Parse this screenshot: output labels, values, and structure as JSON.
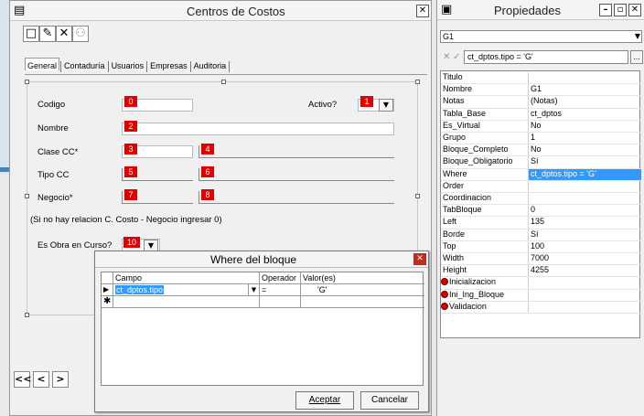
{
  "main_window": {
    "title": "Centros de Costos",
    "tabs": [
      "General",
      "Contaduría",
      "Usuarios",
      "Empresas",
      "Auditoria"
    ],
    "fields": {
      "codigo_label": "Codigo",
      "codigo_tag": "0",
      "activo_label": "Activo?",
      "activo_tag": "1",
      "nombre_label": "Nombre",
      "nombre_tag": "2",
      "clase_label": "Clase CC*",
      "clase_tag": "3",
      "clase_tag2": "4",
      "tipo_label": "Tipo CC",
      "tipo_tag": "5",
      "tipo_tag2": "6",
      "negocio_label": "Negocio*",
      "negocio_tag": "7",
      "negocio_tag2": "8",
      "note": "(Si no hay relacion C. Costo - Negocio ingresar 0)",
      "obra_label": "Es Obra en Curso?",
      "obra_tag": "10"
    },
    "nav": [
      "<<",
      "<",
      ">"
    ]
  },
  "properties": {
    "title": "Propiedades",
    "selector_value": "G1",
    "edit_value": "ct_dptos.tipo = 'G'",
    "rows": [
      {
        "name": "Titulo",
        "value": ""
      },
      {
        "name": "Nombre",
        "value": "G1"
      },
      {
        "name": "Notas",
        "value": "(Notas)"
      },
      {
        "name": "Tabla_Base",
        "value": "ct_dptos"
      },
      {
        "name": "Es_Virtual",
        "value": "No"
      },
      {
        "name": "Grupo",
        "value": "1"
      },
      {
        "name": "Bloque_Completo",
        "value": "No"
      },
      {
        "name": "Bloque_Obligatorio",
        "value": "Sí"
      },
      {
        "name": "Where",
        "value": "ct_dptos.tipo = 'G'"
      },
      {
        "name": "Order",
        "value": ""
      },
      {
        "name": "Coordinacion",
        "value": ""
      },
      {
        "name": "TabBloque",
        "value": "0"
      },
      {
        "name": "Left",
        "value": "135"
      },
      {
        "name": "Borde",
        "value": "Sí"
      },
      {
        "name": "Top",
        "value": "100"
      },
      {
        "name": "Width",
        "value": "7000"
      },
      {
        "name": "Height",
        "value": "4255"
      },
      {
        "name": "Inicializacion",
        "value": ""
      },
      {
        "name": "Ini_Ing_Bloque",
        "value": ""
      },
      {
        "name": "Validacion",
        "value": ""
      }
    ]
  },
  "dialog": {
    "title": "Where del bloque",
    "columns": [
      "Campo",
      "Operador",
      "Valor(es)"
    ],
    "row": {
      "campo": "ct_dptos.tipo",
      "operador": "=",
      "valor": "'G'"
    },
    "accept_label": "Aceptar",
    "cancel_label": "Cancelar"
  },
  "colors": {
    "selection": "#3399ff",
    "tag_red": "#e00000"
  }
}
